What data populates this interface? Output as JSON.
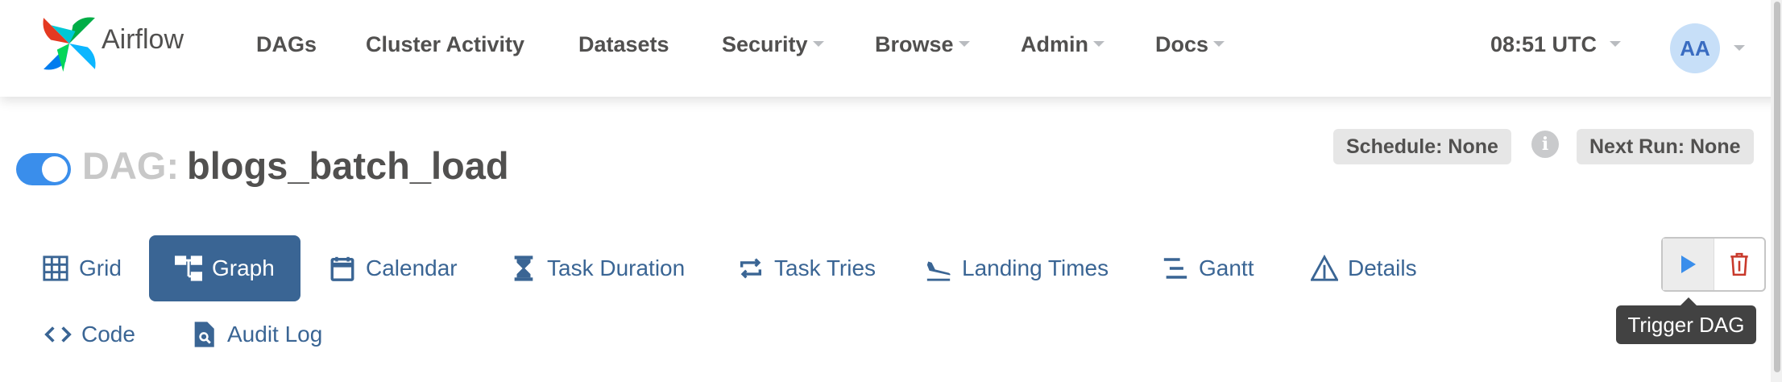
{
  "navbar": {
    "brand": "Airflow",
    "items": [
      {
        "label": "DAGs",
        "dropdown": false
      },
      {
        "label": "Cluster Activity",
        "dropdown": false
      },
      {
        "label": "Datasets",
        "dropdown": false
      },
      {
        "label": "Security",
        "dropdown": true
      },
      {
        "label": "Browse",
        "dropdown": true
      },
      {
        "label": "Admin",
        "dropdown": true
      },
      {
        "label": "Docs",
        "dropdown": true
      }
    ],
    "time": "08:51 UTC",
    "user_initials": "AA"
  },
  "dag": {
    "prefix": "DAG:",
    "name": "blogs_batch_load",
    "paused": false,
    "schedule": "Schedule: None",
    "next_run": "Next Run: None",
    "info_glyph": "i"
  },
  "tabs": [
    {
      "label": "Grid",
      "icon": "grid-icon",
      "active": false
    },
    {
      "label": "Graph",
      "icon": "graph-icon",
      "active": true
    },
    {
      "label": "Calendar",
      "icon": "calendar-icon",
      "active": false
    },
    {
      "label": "Task Duration",
      "icon": "hourglass-icon",
      "active": false
    },
    {
      "label": "Task Tries",
      "icon": "repeat-icon",
      "active": false
    },
    {
      "label": "Landing Times",
      "icon": "plane-landing-icon",
      "active": false
    },
    {
      "label": "Gantt",
      "icon": "gantt-icon",
      "active": false
    },
    {
      "label": "Details",
      "icon": "warning-triangle-icon",
      "active": false
    },
    {
      "label": "Code",
      "icon": "code-icon",
      "active": false
    },
    {
      "label": "Audit Log",
      "icon": "file-search-icon",
      "active": false
    }
  ],
  "actions": {
    "trigger_tooltip": "Trigger DAG",
    "trigger_icon": "play-icon",
    "delete_icon": "trash-icon"
  },
  "colors": {
    "primary": "#3a6594",
    "toggle": "#3a8eeb",
    "delete": "#c8392b"
  }
}
